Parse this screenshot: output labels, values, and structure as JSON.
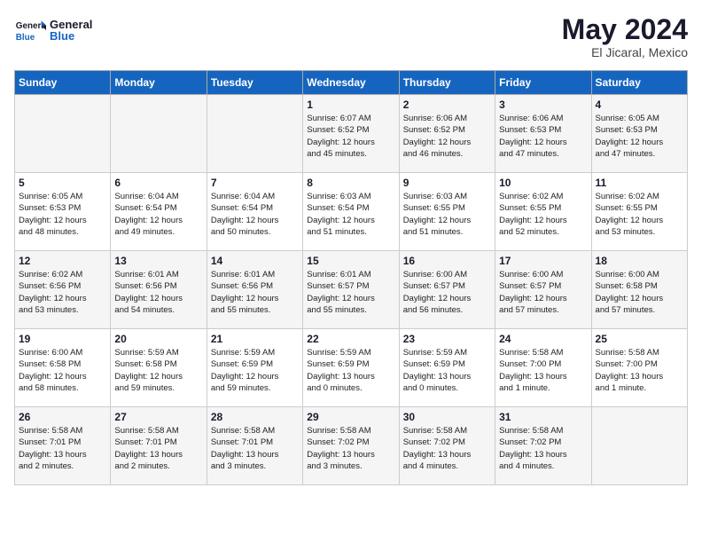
{
  "header": {
    "logo_general": "General",
    "logo_blue": "Blue",
    "month": "May 2024",
    "location": "El Jicaral, Mexico"
  },
  "weekdays": [
    "Sunday",
    "Monday",
    "Tuesday",
    "Wednesday",
    "Thursday",
    "Friday",
    "Saturday"
  ],
  "weeks": [
    [
      {
        "day": "",
        "info": ""
      },
      {
        "day": "",
        "info": ""
      },
      {
        "day": "",
        "info": ""
      },
      {
        "day": "1",
        "info": "Sunrise: 6:07 AM\nSunset: 6:52 PM\nDaylight: 12 hours\nand 45 minutes."
      },
      {
        "day": "2",
        "info": "Sunrise: 6:06 AM\nSunset: 6:52 PM\nDaylight: 12 hours\nand 46 minutes."
      },
      {
        "day": "3",
        "info": "Sunrise: 6:06 AM\nSunset: 6:53 PM\nDaylight: 12 hours\nand 47 minutes."
      },
      {
        "day": "4",
        "info": "Sunrise: 6:05 AM\nSunset: 6:53 PM\nDaylight: 12 hours\nand 47 minutes."
      }
    ],
    [
      {
        "day": "5",
        "info": "Sunrise: 6:05 AM\nSunset: 6:53 PM\nDaylight: 12 hours\nand 48 minutes."
      },
      {
        "day": "6",
        "info": "Sunrise: 6:04 AM\nSunset: 6:54 PM\nDaylight: 12 hours\nand 49 minutes."
      },
      {
        "day": "7",
        "info": "Sunrise: 6:04 AM\nSunset: 6:54 PM\nDaylight: 12 hours\nand 50 minutes."
      },
      {
        "day": "8",
        "info": "Sunrise: 6:03 AM\nSunset: 6:54 PM\nDaylight: 12 hours\nand 51 minutes."
      },
      {
        "day": "9",
        "info": "Sunrise: 6:03 AM\nSunset: 6:55 PM\nDaylight: 12 hours\nand 51 minutes."
      },
      {
        "day": "10",
        "info": "Sunrise: 6:02 AM\nSunset: 6:55 PM\nDaylight: 12 hours\nand 52 minutes."
      },
      {
        "day": "11",
        "info": "Sunrise: 6:02 AM\nSunset: 6:55 PM\nDaylight: 12 hours\nand 53 minutes."
      }
    ],
    [
      {
        "day": "12",
        "info": "Sunrise: 6:02 AM\nSunset: 6:56 PM\nDaylight: 12 hours\nand 53 minutes."
      },
      {
        "day": "13",
        "info": "Sunrise: 6:01 AM\nSunset: 6:56 PM\nDaylight: 12 hours\nand 54 minutes."
      },
      {
        "day": "14",
        "info": "Sunrise: 6:01 AM\nSunset: 6:56 PM\nDaylight: 12 hours\nand 55 minutes."
      },
      {
        "day": "15",
        "info": "Sunrise: 6:01 AM\nSunset: 6:57 PM\nDaylight: 12 hours\nand 55 minutes."
      },
      {
        "day": "16",
        "info": "Sunrise: 6:00 AM\nSunset: 6:57 PM\nDaylight: 12 hours\nand 56 minutes."
      },
      {
        "day": "17",
        "info": "Sunrise: 6:00 AM\nSunset: 6:57 PM\nDaylight: 12 hours\nand 57 minutes."
      },
      {
        "day": "18",
        "info": "Sunrise: 6:00 AM\nSunset: 6:58 PM\nDaylight: 12 hours\nand 57 minutes."
      }
    ],
    [
      {
        "day": "19",
        "info": "Sunrise: 6:00 AM\nSunset: 6:58 PM\nDaylight: 12 hours\nand 58 minutes."
      },
      {
        "day": "20",
        "info": "Sunrise: 5:59 AM\nSunset: 6:58 PM\nDaylight: 12 hours\nand 59 minutes."
      },
      {
        "day": "21",
        "info": "Sunrise: 5:59 AM\nSunset: 6:59 PM\nDaylight: 12 hours\nand 59 minutes."
      },
      {
        "day": "22",
        "info": "Sunrise: 5:59 AM\nSunset: 6:59 PM\nDaylight: 13 hours\nand 0 minutes."
      },
      {
        "day": "23",
        "info": "Sunrise: 5:59 AM\nSunset: 6:59 PM\nDaylight: 13 hours\nand 0 minutes."
      },
      {
        "day": "24",
        "info": "Sunrise: 5:58 AM\nSunset: 7:00 PM\nDaylight: 13 hours\nand 1 minute."
      },
      {
        "day": "25",
        "info": "Sunrise: 5:58 AM\nSunset: 7:00 PM\nDaylight: 13 hours\nand 1 minute."
      }
    ],
    [
      {
        "day": "26",
        "info": "Sunrise: 5:58 AM\nSunset: 7:01 PM\nDaylight: 13 hours\nand 2 minutes."
      },
      {
        "day": "27",
        "info": "Sunrise: 5:58 AM\nSunset: 7:01 PM\nDaylight: 13 hours\nand 2 minutes."
      },
      {
        "day": "28",
        "info": "Sunrise: 5:58 AM\nSunset: 7:01 PM\nDaylight: 13 hours\nand 3 minutes."
      },
      {
        "day": "29",
        "info": "Sunrise: 5:58 AM\nSunset: 7:02 PM\nDaylight: 13 hours\nand 3 minutes."
      },
      {
        "day": "30",
        "info": "Sunrise: 5:58 AM\nSunset: 7:02 PM\nDaylight: 13 hours\nand 4 minutes."
      },
      {
        "day": "31",
        "info": "Sunrise: 5:58 AM\nSunset: 7:02 PM\nDaylight: 13 hours\nand 4 minutes."
      },
      {
        "day": "",
        "info": ""
      }
    ]
  ]
}
